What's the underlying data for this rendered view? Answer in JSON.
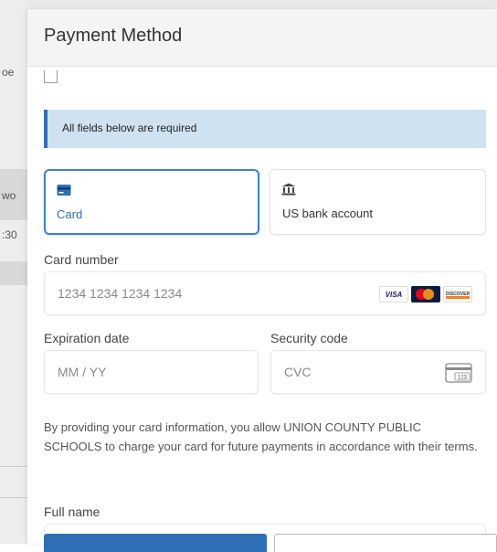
{
  "background": {
    "fragments": [
      "oe",
      "wo",
      ":30"
    ]
  },
  "modal": {
    "title": "Payment Method",
    "required_notice": "All fields below are required",
    "payment_methods": [
      {
        "label": "Card",
        "icon": "credit-card-icon",
        "selected": true
      },
      {
        "label": "US bank account",
        "icon": "bank-icon",
        "selected": false
      }
    ],
    "card_number": {
      "label": "Card number",
      "placeholder": "1234 1234 1234 1234",
      "brands": [
        "VISA",
        "mastercard",
        "DISCOVER"
      ]
    },
    "expiration": {
      "label": "Expiration date",
      "placeholder": "MM / YY"
    },
    "security_code": {
      "label": "Security code",
      "placeholder": "CVC",
      "icon_text": "123"
    },
    "disclaimer": "By providing your card information, you allow UNION COUNTY PUBLIC SCHOOLS to charge your card for future payments in accordance with their terms.",
    "full_name": {
      "label": "Full name"
    }
  },
  "colors": {
    "accent": "#2f6fb5",
    "selected_border": "#3b82d6",
    "banner_bg": "#cfe2f1"
  }
}
